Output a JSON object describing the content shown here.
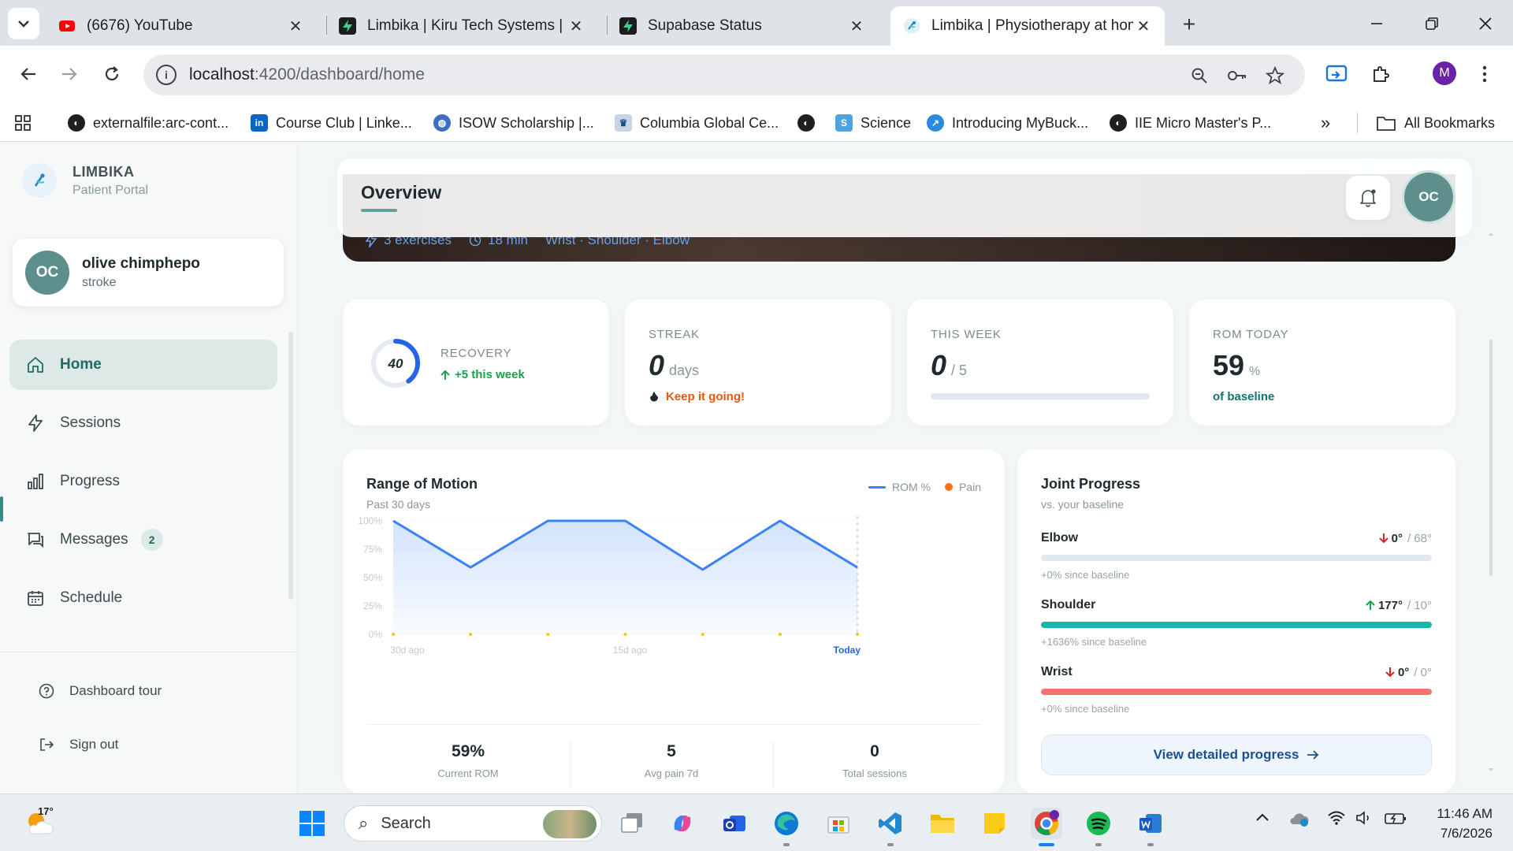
{
  "browser": {
    "tabs": [
      {
        "title": "(6676) YouTube",
        "favicon": "youtube-icon",
        "active": false
      },
      {
        "title": "Limbika | Kiru Tech Systems | Su",
        "favicon": "supabase-icon",
        "active": false
      },
      {
        "title": "Supabase Status",
        "favicon": "supabase-icon",
        "active": false
      },
      {
        "title": "Limbika | Physiotherapy at hom",
        "favicon": "limbika-icon",
        "active": true
      }
    ],
    "url_host": "localhost",
    "url_path": ":4200/dashboard/home",
    "profile_initial": "M",
    "bookmarks": [
      "externalfile:arc-cont...",
      "Course Club | Linke...",
      "ISOW Scholarship |...",
      "Columbia Global Ce...",
      "",
      "Science",
      "Introducing MyBuck...",
      "IIE Micro Master's P..."
    ],
    "all_bookmarks": "All Bookmarks"
  },
  "sidebar": {
    "brand_name": "LIMBIKA",
    "brand_sub": "Patient Portal",
    "patient": {
      "initials": "OC",
      "name": "olive chimphepo",
      "condition": "stroke"
    },
    "nav": [
      {
        "label": "Home",
        "icon": "home-icon",
        "active": true
      },
      {
        "label": "Sessions",
        "icon": "bolt-icon",
        "active": false
      },
      {
        "label": "Progress",
        "icon": "bar-chart-icon",
        "active": false
      },
      {
        "label": "Messages",
        "icon": "chat-icon",
        "active": false,
        "badge": "2"
      },
      {
        "label": "Schedule",
        "icon": "calendar-icon",
        "active": false
      }
    ],
    "footer": {
      "tour": "Dashboard tour",
      "signout": "Sign out"
    }
  },
  "header": {
    "title": "Overview",
    "avatar_initials": "OC"
  },
  "hero": {
    "exercises": "3 exercises",
    "duration": "18 min",
    "areas": "Wrist · Shoulder · Elbow"
  },
  "stats": {
    "recovery": {
      "label": "RECOVERY",
      "value": "40",
      "note": "+5 this week",
      "ring_fraction": 0.4
    },
    "streak": {
      "label": "STREAK",
      "value": "0",
      "unit": "days",
      "note": "Keep it going!"
    },
    "week": {
      "label": "THIS WEEK",
      "value": "0",
      "unit": "/ 5",
      "progress": 0
    },
    "rom": {
      "label": "ROM TODAY",
      "value": "59",
      "unit": "%",
      "note": "of baseline"
    }
  },
  "rom_panel": {
    "title": "Range of Motion",
    "subtitle": "Past 30 days",
    "legend_rom": "ROM %",
    "legend_pain": "Pain",
    "summary": [
      {
        "value": "59%",
        "label": "Current ROM"
      },
      {
        "value": "5",
        "label": "Avg pain 7d"
      },
      {
        "value": "0",
        "label": "Total sessions"
      }
    ]
  },
  "chart_data": {
    "type": "line",
    "title": "Range of Motion",
    "subtitle": "Past 30 days",
    "x_tick_labels": [
      "30d ago",
      "15d ago",
      "Today"
    ],
    "y_tick_labels": [
      "100%",
      "75%",
      "50%",
      "25%",
      "0%"
    ],
    "ylim": [
      0,
      100
    ],
    "grid": true,
    "legend_placement": "top-right",
    "series": [
      {
        "name": "ROM %",
        "color": "#3b82f6",
        "values": [
          100,
          59,
          100,
          100,
          57,
          100,
          59
        ]
      },
      {
        "name": "Pain",
        "color": "#f5c518",
        "values": [
          0,
          0,
          0,
          0,
          0,
          0,
          0
        ]
      }
    ]
  },
  "joint_panel": {
    "title": "Joint Progress",
    "subtitle": "vs. your baseline",
    "joints": [
      {
        "name": "Elbow",
        "value": "0°",
        "baseline": "/ 68°",
        "trend": "down",
        "since": "+0% since baseline",
        "fill": 0,
        "color": "#e3e8f0"
      },
      {
        "name": "Shoulder",
        "value": "177°",
        "baseline": "/ 10°",
        "trend": "up",
        "since": "+1636% since baseline",
        "fill": 1,
        "color": "#14b8a6"
      },
      {
        "name": "Wrist",
        "value": "0°",
        "baseline": "/ 0°",
        "trend": "down",
        "since": "+0% since baseline",
        "fill": 1,
        "color": "#f87171"
      }
    ],
    "button": "View detailed progress"
  },
  "taskbar": {
    "temperature": "17°",
    "search": "Search",
    "time": "11:46 AM",
    "date": "7/6/2026"
  }
}
